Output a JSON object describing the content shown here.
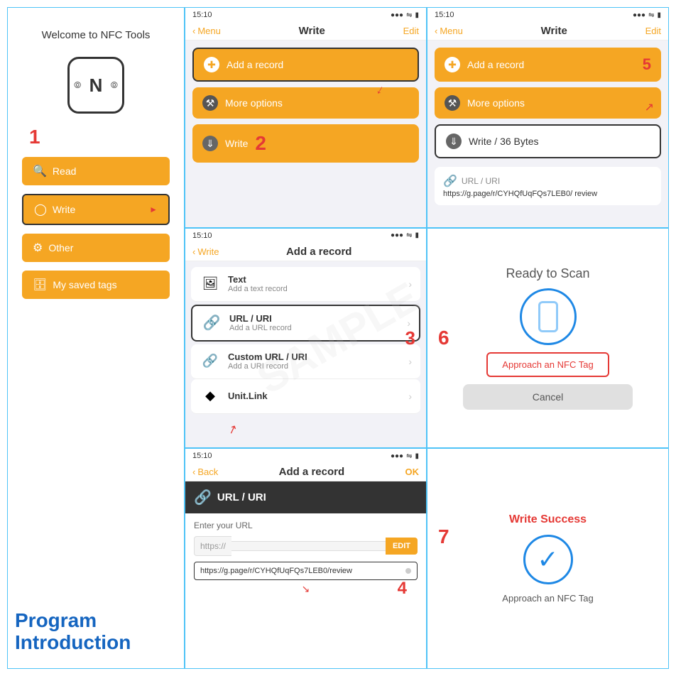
{
  "page": {
    "title": "NFC Tools Program Introduction"
  },
  "panel1": {
    "welcome": "Welcome to NFC Tools",
    "step": "1",
    "buttons": {
      "read": "Read",
      "write": "Write",
      "other": "Other",
      "mySavedTags": "My saved tags"
    }
  },
  "panel2": {
    "time": "15:10",
    "nav": {
      "back": "Menu",
      "title": "Write",
      "action": "Edit"
    },
    "buttons": {
      "addRecord": "Add a record",
      "moreOptions": "More options",
      "write": "Write"
    },
    "step": "2"
  },
  "panel3": {
    "time": "15:10",
    "nav": {
      "back": "Write",
      "title": "Add a record"
    },
    "items": [
      {
        "title": "Text",
        "subtitle": "Add a text record"
      },
      {
        "title": "URL / URI",
        "subtitle": "Add a URL record"
      },
      {
        "title": "Custom URL / URI",
        "subtitle": "Add a URI record"
      },
      {
        "title": "Unit.Link",
        "subtitle": ""
      }
    ],
    "step": "3"
  },
  "panel4": {
    "time": "15:10",
    "nav": {
      "back": "Back",
      "title": "Add a record",
      "action": "OK"
    },
    "header": "URL / URI",
    "label": "Enter your URL",
    "prefix": "https://",
    "editBtn": "EDIT",
    "urlValue": "https://g.page/r/CYHQfUqFQs7LEB0/review",
    "step": "4"
  },
  "panel5": {
    "time": "15:10",
    "nav": {
      "back": "Menu",
      "title": "Write",
      "action": "Edit"
    },
    "buttons": {
      "addRecord": "Add a record",
      "moreOptions": "More options",
      "writeBytes": "Write / 36 Bytes"
    },
    "urlLabel": "URL / URI",
    "urlValue": "https://g.page/r/CYHQfUqFQs7LEB0/\nreview",
    "step": "5"
  },
  "panel6": {
    "title": "Ready to Scan",
    "approachBtn": "Approach an NFC Tag",
    "cancelBtn": "Cancel",
    "step": "6"
  },
  "panel7": {
    "title": "Write Success",
    "approachText": "Approach an NFC Tag",
    "step": "7"
  },
  "colors": {
    "orange": "#f5a623",
    "blue": "#1e88e5",
    "red": "#e53935",
    "darkBlue": "#1565c0"
  }
}
